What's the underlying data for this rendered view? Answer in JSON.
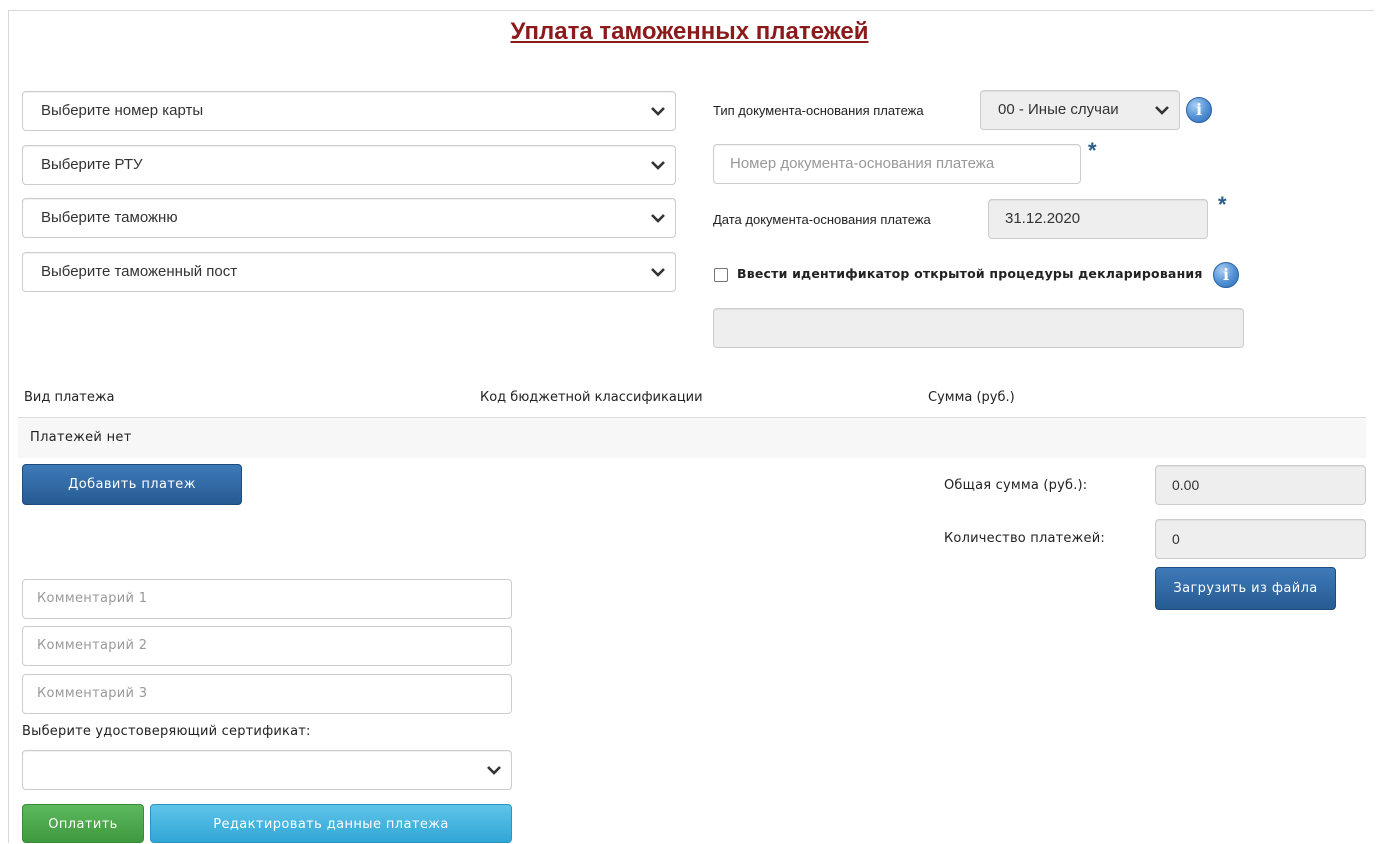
{
  "title": "Уплата таможенных платежей",
  "left_selects": [
    {
      "label": "Выберите номер карты"
    },
    {
      "label": "Выберите РТУ"
    },
    {
      "label": "Выберите таможню"
    },
    {
      "label": "Выберите таможенный пост"
    }
  ],
  "doc_type": {
    "label": "Тип документа-основания платежа",
    "value": "00 - Иные случаи"
  },
  "doc_number": {
    "placeholder": "Номер документа-основания платежа",
    "required_mark": "*"
  },
  "doc_date": {
    "label": "Дата документа-основания платежа",
    "value": "31.12.2020",
    "required_mark": "*"
  },
  "procedure": {
    "checkbox_label": "Ввести идентификатор открытой процедуры декларирования",
    "checked": false,
    "value": ""
  },
  "info_icon_glyph": "i",
  "table": {
    "headers": [
      "Вид платежа",
      "Код бюджетной классификации",
      "Сумма (руб.)"
    ],
    "empty_text": "Платежей нет"
  },
  "buttons": {
    "add_payment": "Добавить платеж",
    "load_from_file": "Загрузить из файла",
    "pay": "Оплатить",
    "edit_payment": "Редактировать данные платежа"
  },
  "totals": {
    "total_label": "Общая сумма (руб.):",
    "total_value": "0.00",
    "count_label": "Количество платежей:",
    "count_value": "0"
  },
  "comments": [
    {
      "placeholder": "Комментарий 1"
    },
    {
      "placeholder": "Комментарий 2"
    },
    {
      "placeholder": "Комментарий 3"
    }
  ],
  "certificate": {
    "label": "Выберите удостоверяющий сертификат:",
    "value": ""
  },
  "colors": {
    "title": "#8b1a1a",
    "primary": "#265b93",
    "success": "#3f9a3f",
    "info": "#31a6d6"
  }
}
